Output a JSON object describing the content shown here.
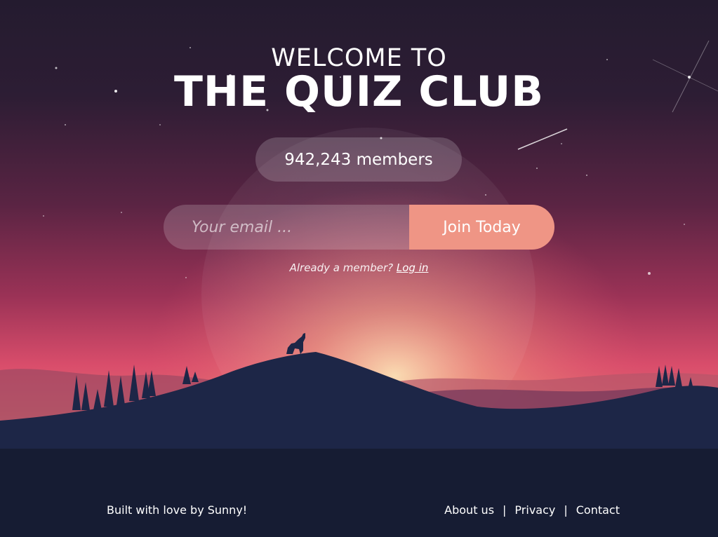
{
  "header": {
    "welcome": "WELCOME TO",
    "title": "THE QUIZ CLUB"
  },
  "stats": {
    "members_label": "942,243 members"
  },
  "signup": {
    "email_placeholder": "Your email ...",
    "join_label": "Join Today"
  },
  "login_prompt": {
    "text": "Already a member?",
    "link_label": "Log in"
  },
  "footer": {
    "credit": "Built with love by Sunny!",
    "links": [
      "About us",
      "Privacy",
      "Contact"
    ],
    "separator": "|"
  },
  "colors": {
    "sky_top": "#2a1d33",
    "sky_mid": "#7d2a4e",
    "horizon": "#e0596f",
    "glow": "#f7c49a",
    "mountain": "#1d2647",
    "ground": "#161c33",
    "button": "#ef9585"
  },
  "icons": {
    "wolf": "wolf-silhouette-icon",
    "trees": "pine-trees-icon",
    "moon": "moon-icon",
    "stars": "star-icon"
  }
}
